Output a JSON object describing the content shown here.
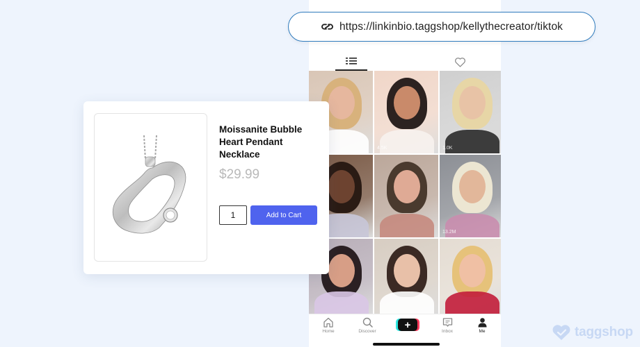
{
  "url_bar": {
    "url": "https://linkinbio.taggshop/kellythecreator/tiktok",
    "icon": "link-icon"
  },
  "tabs": [
    {
      "name": "grid-tab",
      "icon": "grid-icon",
      "active": true
    },
    {
      "name": "likes-tab",
      "icon": "heart-icon",
      "active": false
    }
  ],
  "grid": {
    "tiles": [
      {
        "bg": "#d9c6b6",
        "skin": "#e6b79e",
        "hair": "#d8b27c",
        "views": "",
        "accent": "#ffffff"
      },
      {
        "bg": "#f0d6c8",
        "skin": "#c98a6a",
        "hair": "#2c2220",
        "views": "4.5K",
        "accent": "#f7f2ee"
      },
      {
        "bg": "#cfcfcf",
        "skin": "#e8c3a6",
        "hair": "#e7d6a6",
        "views": "1.0K",
        "accent": "#2a2a2a"
      },
      {
        "bg": "#7a5a46",
        "skin": "#6d4330",
        "hair": "#2a1b14",
        "views": "",
        "accent": "#c8c6d8"
      },
      {
        "bg": "#bba79a",
        "skin": "#dfaa95",
        "hair": "#4a3a2e",
        "views": "",
        "accent": "#c58a7e"
      },
      {
        "bg": "#8c8f95",
        "skin": "#e2b79a",
        "hair": "#ece6d2",
        "views": "13.2M",
        "accent": "#c98dae"
      },
      {
        "bg": "#b8aeb8",
        "skin": "#d79e86",
        "hair": "#2b2023",
        "views": "",
        "accent": "#d9c7e6"
      },
      {
        "bg": "#d7cdc2",
        "skin": "#e8c0a8",
        "hair": "#3b2a24",
        "views": "",
        "accent": "#ffffff"
      },
      {
        "bg": "#e4dcd2",
        "skin": "#f0c0a4",
        "hair": "#e6c27a",
        "views": "",
        "accent": "#c21d3a"
      }
    ]
  },
  "bottom_nav": {
    "items": [
      {
        "label": "Home",
        "icon": "home-icon"
      },
      {
        "label": "Discover",
        "icon": "search-icon"
      },
      {
        "label": "",
        "icon": "create-plus-icon"
      },
      {
        "label": "Inbox",
        "icon": "inbox-icon"
      },
      {
        "label": "Me",
        "icon": "profile-icon"
      }
    ]
  },
  "product": {
    "title": "Moissanite Bubble Heart Pendant Necklace",
    "price": "$29.99",
    "quantity": "1",
    "add_to_cart_label": "Add to Cart",
    "image_icon": "heart-pendant-necklace-image"
  },
  "brand": {
    "name": "taggshop",
    "logo_icon": "heart-tag-logo-icon"
  },
  "colors": {
    "background": "#eef4fd",
    "accent_button": "#4f63ee",
    "url_border": "#2f7bbd",
    "price_text": "#b9b9b9"
  }
}
